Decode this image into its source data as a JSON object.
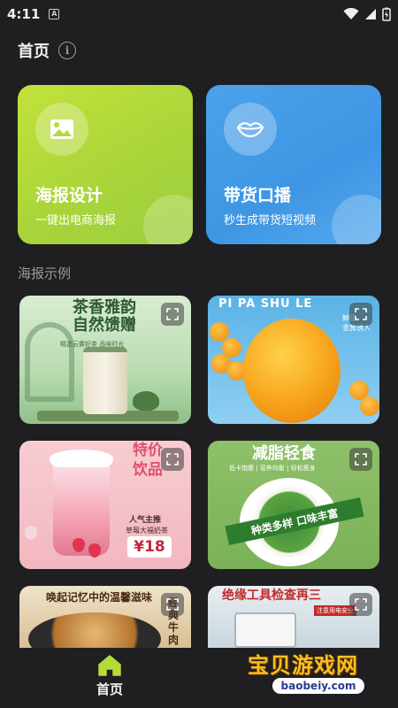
{
  "status_bar": {
    "time": "4:11",
    "notification_letter": "A"
  },
  "header": {
    "title": "首页",
    "info_icon": "i"
  },
  "features": [
    {
      "title": "海报设计",
      "subtitle": "一键出电商海报",
      "icon": "image-icon",
      "color": "#b4db3a"
    },
    {
      "title": "带货口播",
      "subtitle": "秒生成带货短视频",
      "icon": "lips-icon",
      "color": "#4a9fe8"
    }
  ],
  "section": {
    "title": "海报示例"
  },
  "examples": {
    "tea": {
      "title_line1": "茶香雅韵",
      "title_line2": "自然馈赠",
      "subtitle": "精选云雾好茶 品味时光"
    },
    "loquat": {
      "title": "PI PA SHU LE",
      "tag_line1": "鲜甜",
      "tag_line2": "金黄诱人"
    },
    "milk": {
      "title_line1": "特价",
      "title_line2": "饮品",
      "hot": "人气主推",
      "name": "草莓大福奶茶",
      "price": "¥18"
    },
    "salad": {
      "title": "减脂轻食",
      "tags": "低卡饱腹 | 营养均衡 | 轻松瘦身",
      "ribbon": "种类多样 口味丰富"
    },
    "noodle": {
      "title": "唤起记忆中的温馨滋味",
      "side": "经典牛肉"
    },
    "tools": {
      "title": "绝缘工具检查再三",
      "tag": "注意用电安全"
    }
  },
  "bottom_nav": {
    "home_label": "首页",
    "home_icon": "home-icon",
    "active_color": "#b4db3a"
  },
  "watermark": {
    "text": "宝贝游戏网",
    "url": "baobeiy.com"
  }
}
